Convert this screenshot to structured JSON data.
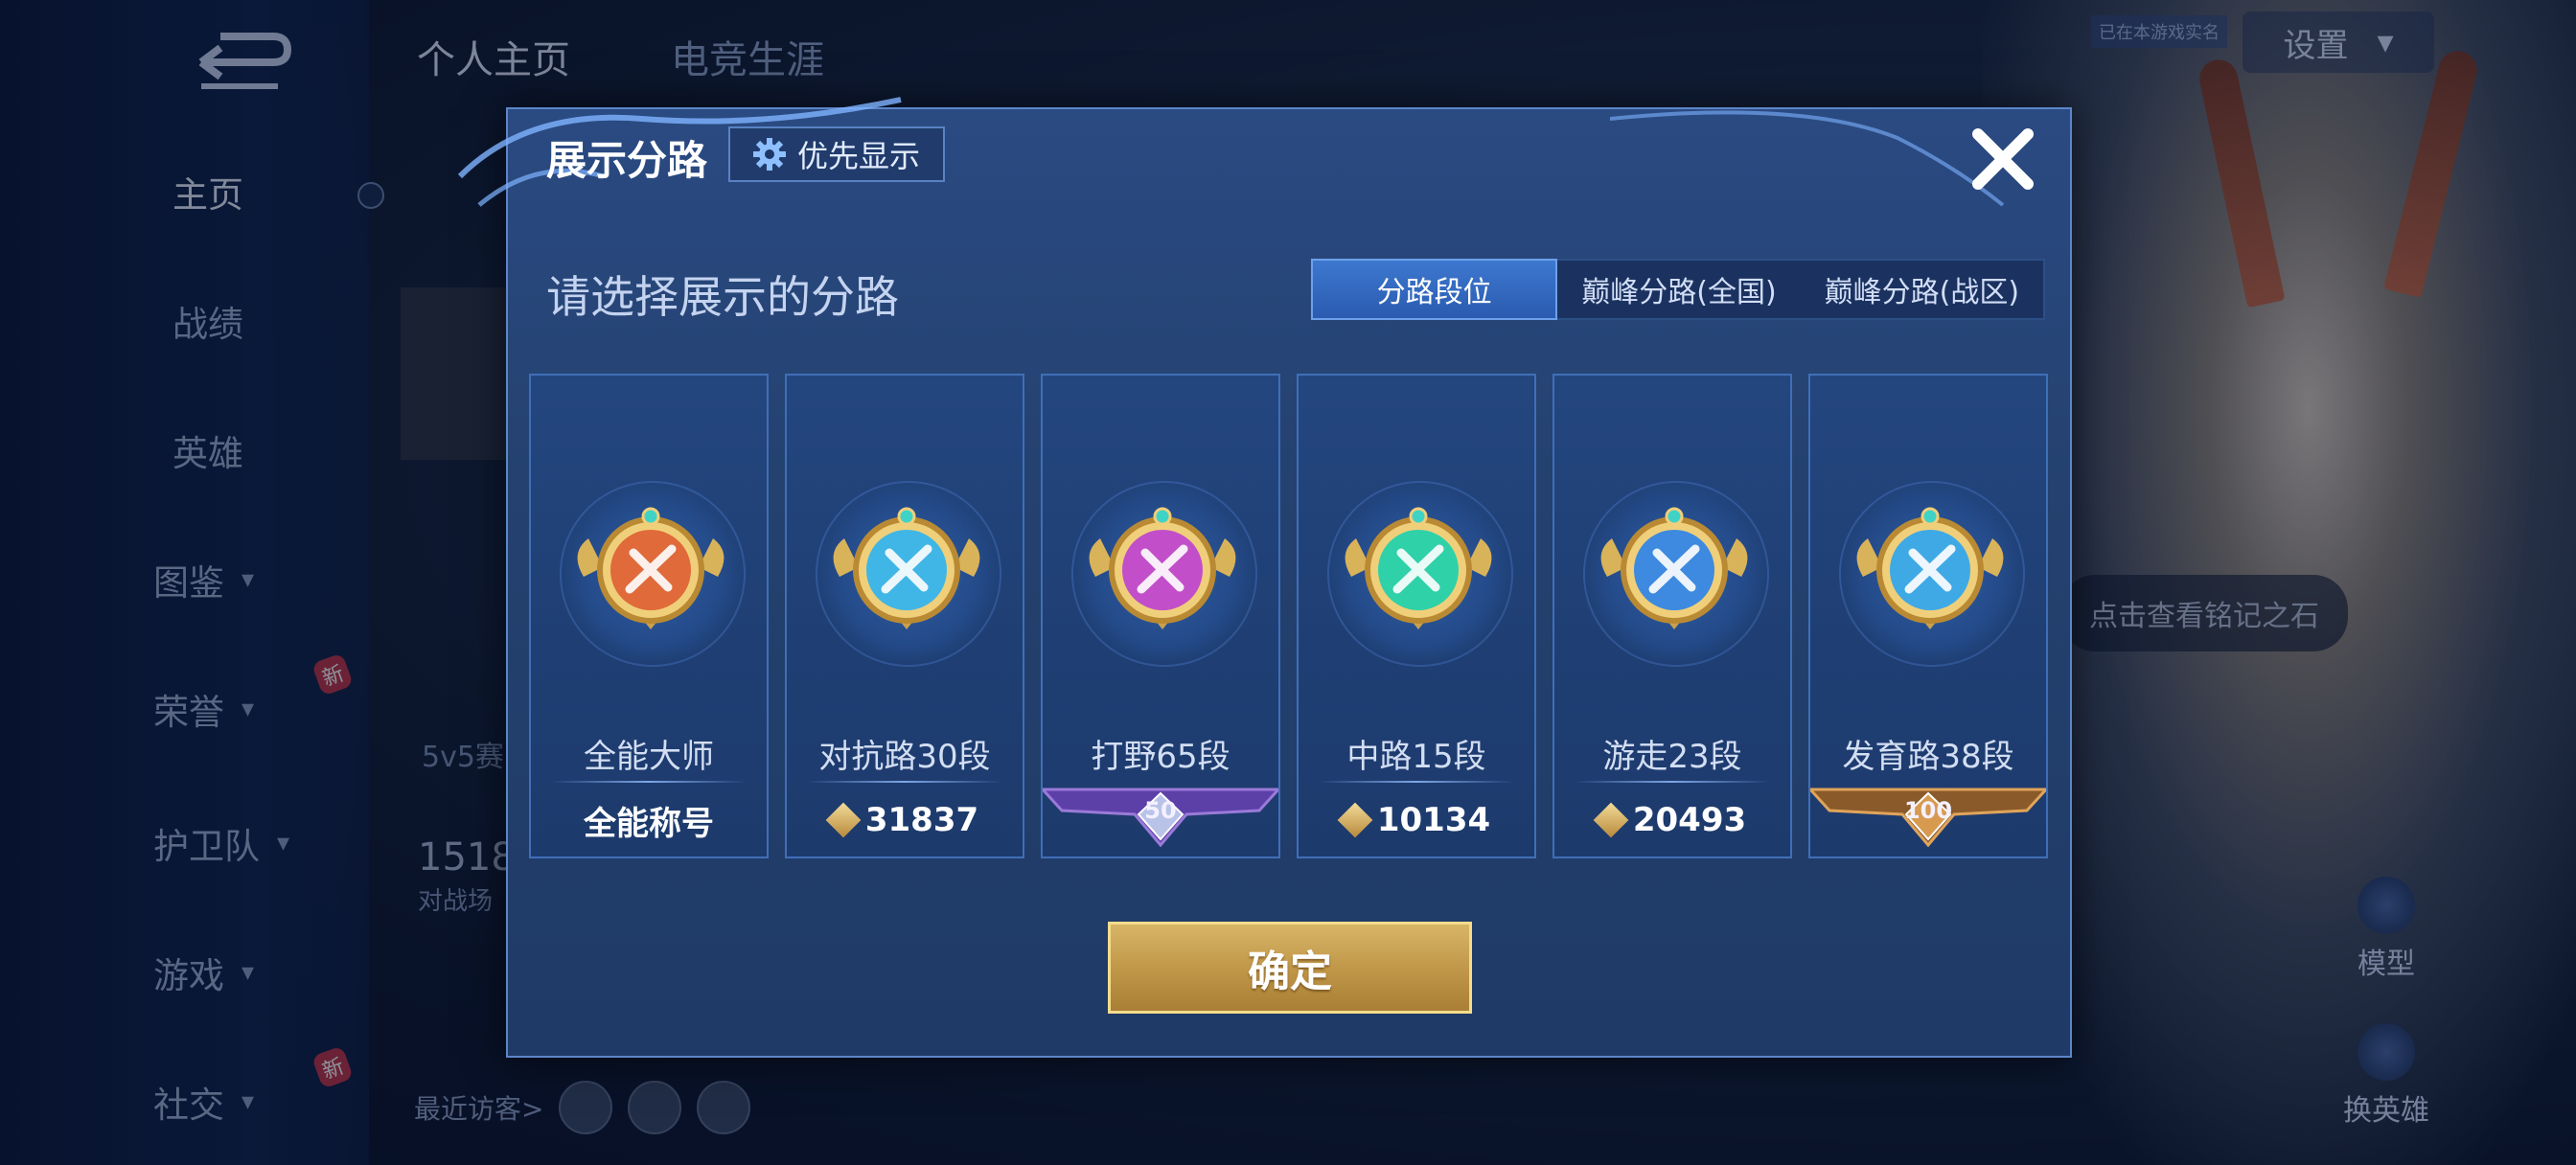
{
  "background": {
    "top_tabs": [
      "个人主页",
      "电竞生涯"
    ],
    "settings_label": "设置",
    "realname_tag": "已在本游戏实名",
    "nav": [
      {
        "label": "主页",
        "chevron": false,
        "badge": ""
      },
      {
        "label": "战绩",
        "chevron": false,
        "badge": ""
      },
      {
        "label": "英雄",
        "chevron": false,
        "badge": ""
      },
      {
        "label": "图鉴",
        "chevron": true,
        "badge": ""
      },
      {
        "label": "荣誉",
        "chevron": true,
        "badge": "新"
      },
      {
        "label": "护卫队",
        "chevron": true,
        "badge": ""
      },
      {
        "label": "游戏",
        "chevron": true,
        "badge": ""
      },
      {
        "label": "社交",
        "chevron": true,
        "badge": "新"
      }
    ],
    "rank_fragment": "5v5赛",
    "battle_number": "1518",
    "battle_sub": "对战场",
    "recent_visitors": "最近访客>",
    "inscription_hint": "点击查看铭记之石",
    "model_label": "模型",
    "change_hero_label": "换英雄"
  },
  "dialog": {
    "title": "展示分路",
    "priority_button": "优先显示",
    "subtitle": "请选择展示的分路",
    "segments": [
      "分路段位",
      "巅峰分路(全国)",
      "巅峰分路(战区)"
    ],
    "selected_segment": 0,
    "cards": [
      {
        "name": "全能大师",
        "value": "全能称号",
        "type": "title",
        "emblem": "all-round-emblem",
        "color": "#e06a3a"
      },
      {
        "name": "对抗路30段",
        "value": "31837",
        "type": "score",
        "emblem": "clash-lane-emblem",
        "color": "#3fb6e6"
      },
      {
        "name": "打野65段",
        "value": "50",
        "type": "ribbon-purple",
        "emblem": "jungle-dragon-emblem",
        "color": "#c24fc9"
      },
      {
        "name": "中路15段",
        "value": "10134",
        "type": "score",
        "emblem": "mid-lane-emblem",
        "color": "#2fd1a8"
      },
      {
        "name": "游走23段",
        "value": "20493",
        "type": "score",
        "emblem": "roam-wings-emblem",
        "color": "#3d8ae0"
      },
      {
        "name": "发育路38段",
        "value": "100",
        "type": "ribbon-gold",
        "emblem": "farm-lane-emblem",
        "color": "#3fa9e6"
      }
    ],
    "confirm_button": "确定"
  },
  "icons": {
    "close": "close-icon",
    "gear": "gear-icon",
    "back": "back-arrow-icon"
  }
}
